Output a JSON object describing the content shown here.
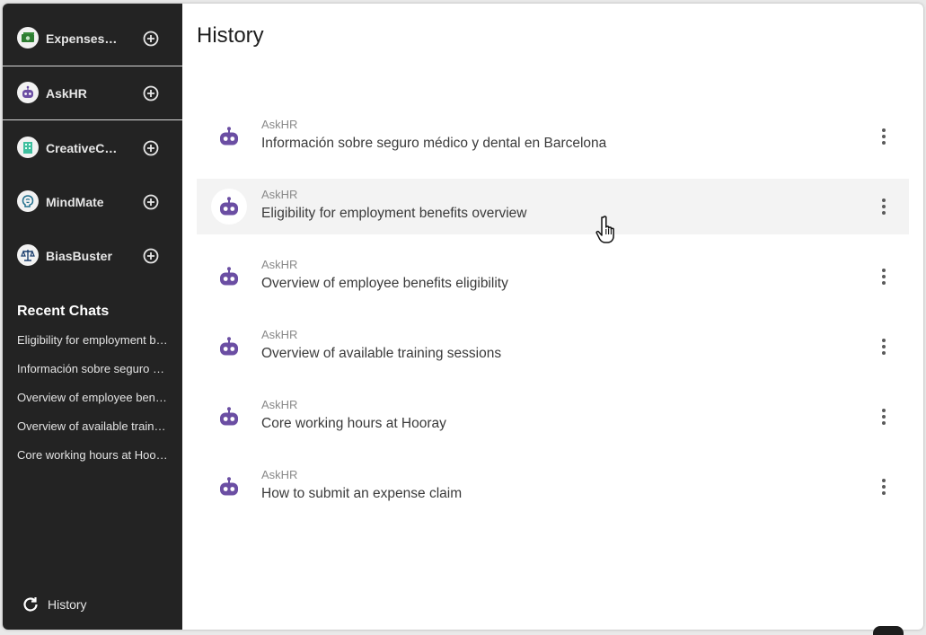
{
  "assistants": [
    {
      "name": "ExpensesE...",
      "icon": "money-icon"
    },
    {
      "name": "AskHR",
      "icon": "robot-icon"
    },
    {
      "name": "CreativeCh...",
      "icon": "building-icon"
    },
    {
      "name": "MindMate",
      "icon": "brain-icon"
    },
    {
      "name": "BiasBuster",
      "icon": "scales-icon"
    }
  ],
  "sidebar": {
    "recent_title": "Recent Chats",
    "recent": [
      "Eligibility for employment benefits overview",
      "Información sobre seguro médico y dental en Barcelona",
      "Overview of employee benefits eligibility",
      "Overview of available training sessions",
      "Core working hours at Hooray"
    ],
    "history_label": "History"
  },
  "main": {
    "title": "History",
    "chats": [
      {
        "assistant": "AskHR",
        "title": "Información sobre seguro médico y dental en Barcelona"
      },
      {
        "assistant": "AskHR",
        "title": "Eligibility for employment benefits overview"
      },
      {
        "assistant": "AskHR",
        "title": "Overview of employee benefits eligibility"
      },
      {
        "assistant": "AskHR",
        "title": "Overview of available training sessions"
      },
      {
        "assistant": "AskHR",
        "title": "Core working hours at Hooray"
      },
      {
        "assistant": "AskHR",
        "title": "How to submit an expense claim"
      }
    ]
  },
  "colors": {
    "sidebar_bg": "#232323",
    "robot_purple": "#6b4ea3",
    "hover_row": "#f3f3f3",
    "money_green": "#2e7d32",
    "teal": "#3fbf9f"
  }
}
